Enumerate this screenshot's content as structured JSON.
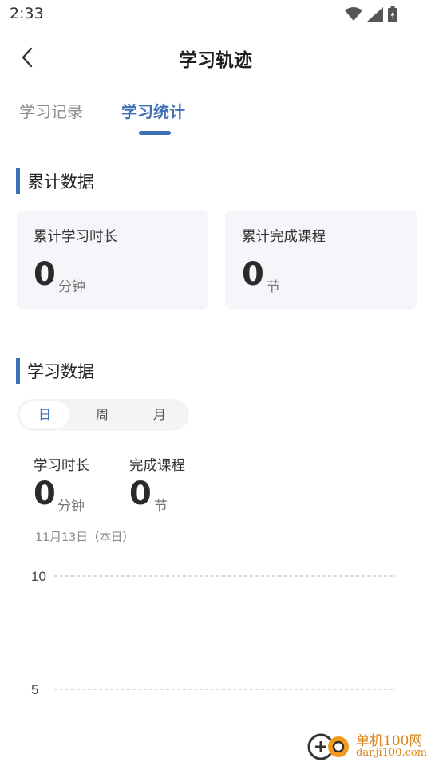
{
  "status_bar": {
    "time": "2:33"
  },
  "nav": {
    "title": "学习轨迹"
  },
  "tabs": [
    {
      "label": "学习记录",
      "active": false
    },
    {
      "label": "学习统计",
      "active": true
    }
  ],
  "cumulative": {
    "title": "累计数据",
    "cards": [
      {
        "label": "累计学习时长",
        "value": "0",
        "unit": "分钟"
      },
      {
        "label": "累计完成课程",
        "value": "0",
        "unit": "节"
      }
    ]
  },
  "study": {
    "title": "学习数据",
    "periods": [
      {
        "label": "日",
        "active": true
      },
      {
        "label": "周",
        "active": false
      },
      {
        "label": "月",
        "active": false
      }
    ],
    "stats": [
      {
        "label": "学习时长",
        "value": "0",
        "unit": "分钟"
      },
      {
        "label": "完成课程",
        "value": "0",
        "unit": "节"
      }
    ],
    "date": "11月13日（本日）"
  },
  "chart_data": {
    "type": "bar",
    "y_ticks": [
      10,
      5
    ],
    "ylim": [
      0,
      10
    ],
    "grid": true
  },
  "watermark": {
    "name": "单机100网",
    "url": "danji100.com"
  },
  "colors": {
    "accent": "#3f6fb6",
    "card_bg": "#f4f6f9"
  }
}
